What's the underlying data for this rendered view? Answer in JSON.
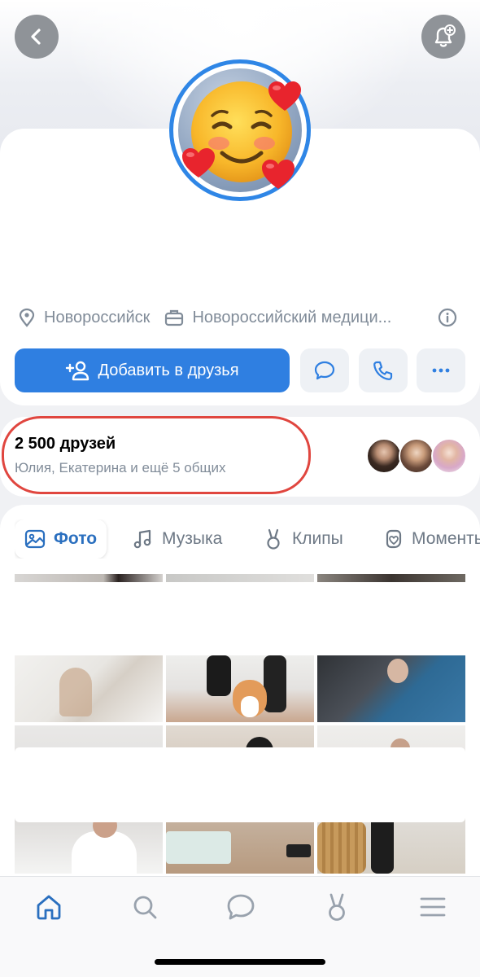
{
  "header": {
    "back_icon": "chevron-left-icon",
    "bell_icon": "bell-plus-icon"
  },
  "profile": {
    "avatar_emoji": "☺️",
    "hearts": "❤️",
    "city": "Новороссийск",
    "work": "Новороссийский медици...",
    "buttons": {
      "add_friend": "Добавить в друзья"
    }
  },
  "friends": {
    "count": "2 500 друзей",
    "mutual": "Юлия, Екатерина и ещё 5 общих"
  },
  "media_tabs": [
    {
      "label": "Фото",
      "icon": "photo-icon",
      "active": true
    },
    {
      "label": "Музыка",
      "icon": "music-icon",
      "active": false
    },
    {
      "label": "Клипы",
      "icon": "clips-icon",
      "active": false
    },
    {
      "label": "Моменты",
      "icon": "moments-icon",
      "active": false
    }
  ],
  "bottom_nav": [
    "home-icon",
    "search-icon",
    "messages-icon",
    "clips-icon",
    "menu-icon"
  ],
  "colors": {
    "accent": "#2f7fe1",
    "highlight_oval": "#e0463f",
    "secondary_text": "#818c99"
  }
}
